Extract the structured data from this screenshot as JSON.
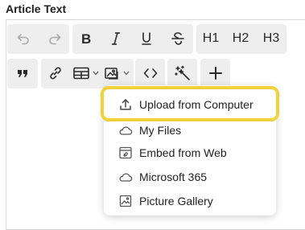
{
  "field": {
    "label": "Article Text"
  },
  "toolbar": {
    "heading1": "H1",
    "heading2": "H2",
    "heading3": "H3"
  },
  "insert_image_menu": {
    "items": [
      {
        "label": "Upload from Computer",
        "icon": "upload-icon"
      },
      {
        "label": "My Files",
        "icon": "cloud-icon"
      },
      {
        "label": "Embed from Web",
        "icon": "embed-web-icon"
      },
      {
        "label": "Microsoft 365",
        "icon": "cloud-icon"
      },
      {
        "label": "Picture Gallery",
        "icon": "gallery-icon"
      }
    ]
  },
  "colors": {
    "highlight": "#f2d23a",
    "toolbar_bg": "#eeeeee"
  }
}
